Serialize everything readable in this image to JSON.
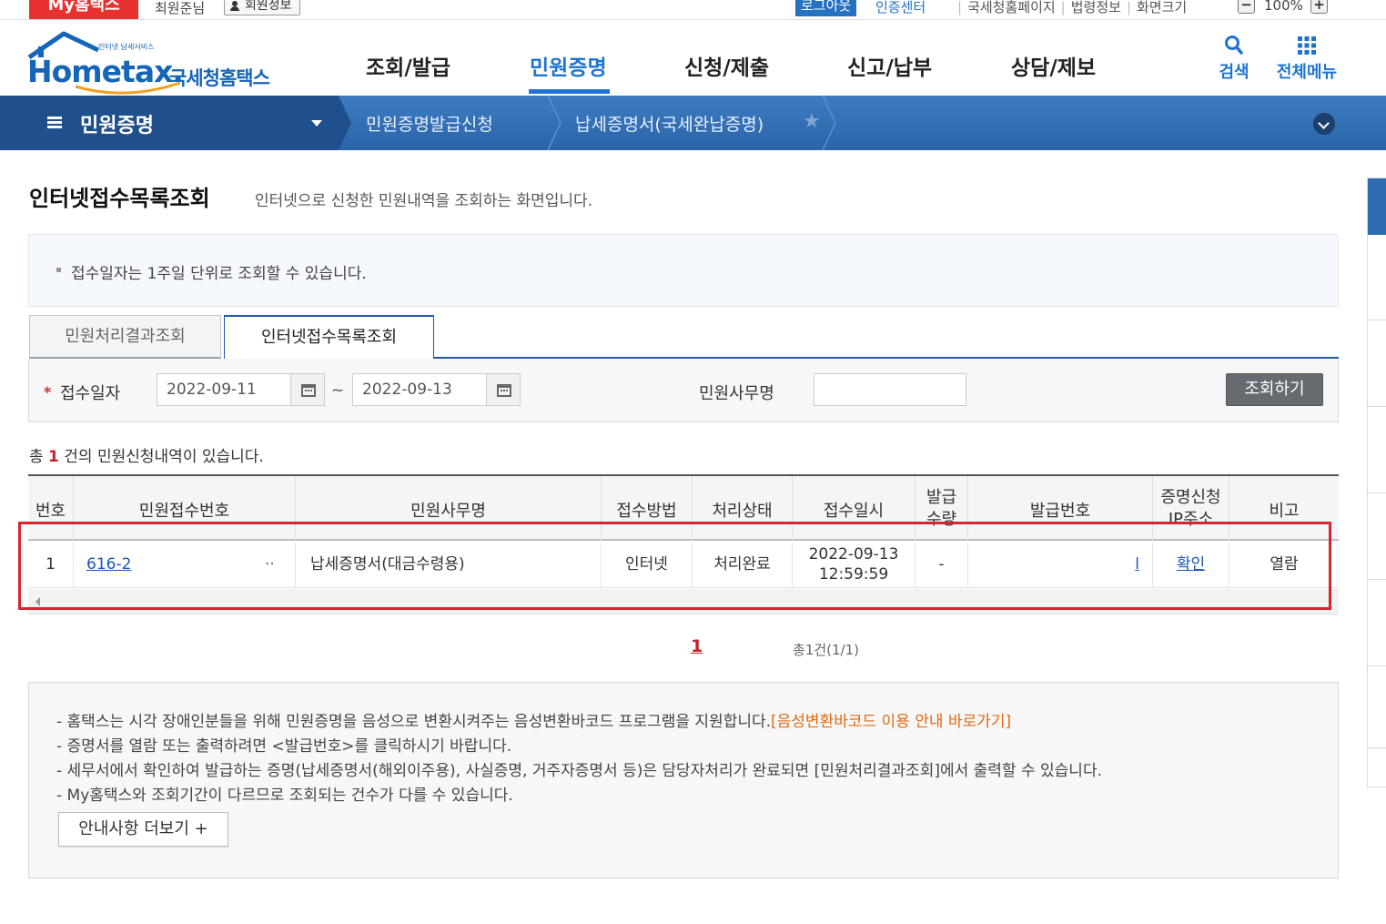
{
  "topbar": {
    "brand": "My홈택스",
    "user_name": "최원준님",
    "member_info_btn": "회원정보",
    "logout_btn": "로그아웃",
    "cert_center": "인증센터",
    "nts_homepage": "국세청홈페이지",
    "law_info": "법령정보",
    "screen_size_label": "화면크기",
    "zoom_value": "100%",
    "zoom_minus": "−",
    "zoom_plus": "+"
  },
  "header": {
    "logo_main": "Hometax.",
    "logo_sub": "국세청홈택스",
    "logo_small": "인터넷 납세서비스",
    "nav": [
      "조회/발급",
      "민원증명",
      "신청/제출",
      "신고/납부",
      "상담/제보"
    ],
    "active_nav": "민원증명",
    "search_label": "검색",
    "all_menu_label": "전체메뉴"
  },
  "breadcrumb": {
    "section": "민원증명",
    "level2": "민원증명발급신청",
    "level3": "납세증명서(국세완납증명)"
  },
  "page": {
    "title": "인터넷접수목록조회",
    "description": "인터넷으로 신청한 민원내역을 조회하는 화면입니다.",
    "notice": "접수일자는 1주일 단위로 조회할 수 있습니다."
  },
  "tabs": [
    {
      "label": "민원처리결과조회",
      "active": false
    },
    {
      "label": "인터넷접수목록조회",
      "active": true
    }
  ],
  "search": {
    "date_label": "접수일자",
    "required_mark": "*",
    "date_from": "2022-09-11",
    "date_to": "2022-09-13",
    "range_sep": "~",
    "office_label": "민원사무명",
    "office_value": "",
    "submit_btn": "조회하기"
  },
  "result": {
    "prefix": "총",
    "count": "1",
    "suffix": "건의 민원신청내역이 있습니다."
  },
  "table": {
    "headers": {
      "no": "번호",
      "receipt_no": "민원접수번호",
      "office_name": "민원사무명",
      "method": "접수방법",
      "status": "처리상태",
      "received_at": "접수일시",
      "issue_qty": "발급\n수량",
      "issue_no": "발급번호",
      "ip_addr": "증명신청\nIP주소",
      "remarks": "비고"
    },
    "rows": [
      {
        "no": "1",
        "receipt_no": "616-2",
        "receipt_no_tail": "··",
        "office_name": "납세증명서(대금수령용)",
        "method": "인터넷",
        "status": "처리완료",
        "received_date": "2022-09-13",
        "received_time": "12:59:59",
        "issue_qty": "-",
        "issue_no": "l",
        "ip_addr": "확인",
        "remarks": "열람"
      }
    ]
  },
  "pager": {
    "current": "1",
    "total": "총1건(1/1)"
  },
  "guide": {
    "lines": [
      "- 홈택스는 시각 장애인분들을 위해 민원증명을 음성으로 변환시켜주는 음성변환바코드 프로그램을 지원합니다.",
      "- 증명서를 열람 또는 출력하려면 <발급번호>를 클릭하시기 바랍니다.",
      "- 세무서에서 확인하여 발급하는 증명(납세증명서(해외이주용), 사실증명, 거주자증명서 등)은 담당자처리가 완료되면 [민원처리결과조회]에서 출력할 수 있습니다.",
      "- My홈택스와 조회기간이 다르므로 조회되는 건수가 다를 수 있습니다."
    ],
    "barcode_link": "[음성변환바코드 이용 안내 바로가기]",
    "more_btn": "안내사항 더보기 +"
  },
  "colors": {
    "brand_blue": "#1e74d2",
    "crumb_bar": "#2f6bb0",
    "brand_red": "#e8312f",
    "highlight": "#d8242e",
    "link": "#1a56b7"
  }
}
